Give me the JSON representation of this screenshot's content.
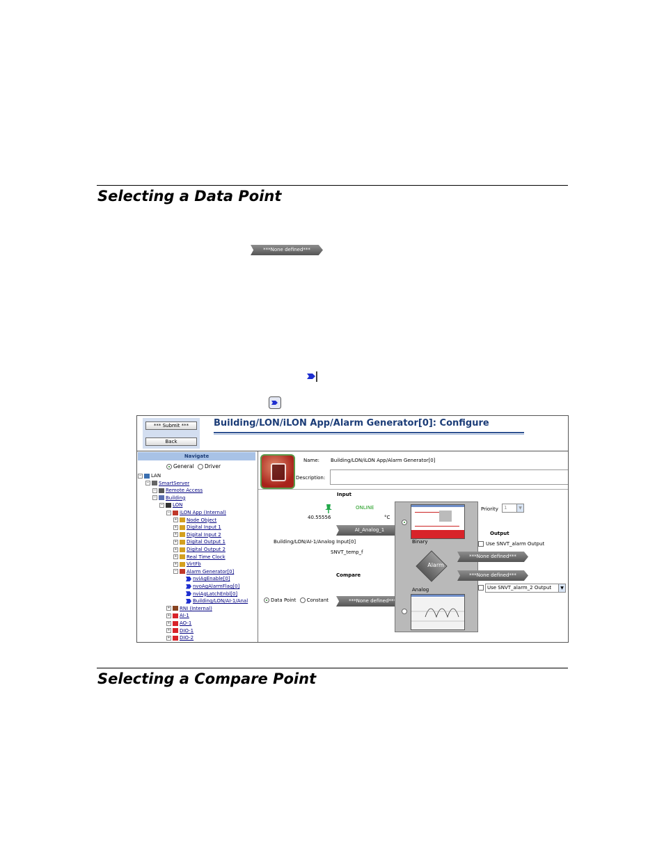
{
  "sections": {
    "data_point_title": "Selecting a Data Point",
    "compare_point_title": "Selecting a Compare Point"
  },
  "inline": {
    "none_defined_tag": "***None defined***"
  },
  "screenshot": {
    "buttons": {
      "submit": "*** Submit ***",
      "back": "Back"
    },
    "title": "Building/LON/iLON App/Alarm Generator[0]: Configure",
    "nav": {
      "header": "Navigate",
      "radio_general": "General",
      "radio_driver": "Driver",
      "tree": [
        {
          "label": "LAN",
          "plain": true
        },
        {
          "label": "SmartServer"
        },
        {
          "label": "Remote Access"
        },
        {
          "label": "Building"
        },
        {
          "label": "LON"
        },
        {
          "label": "iLON App (Internal)"
        },
        {
          "label": "Node Object"
        },
        {
          "label": "Digital Input 1"
        },
        {
          "label": "Digital Input 2"
        },
        {
          "label": "Digital Output 1"
        },
        {
          "label": "Digital Output 2"
        },
        {
          "label": "Real Time Clock"
        },
        {
          "label": "VirtFb"
        },
        {
          "label": "Alarm Generator[0]"
        },
        {
          "label": "nviAgEnable[0]"
        },
        {
          "label": "nvoAgAlarmFlag[0]"
        },
        {
          "label": "nviAgLatchEnbl[0]"
        },
        {
          "label": "Building/LON/AI-1/Anal"
        },
        {
          "label": "RNI (Internal)"
        },
        {
          "label": "AI-1"
        },
        {
          "label": "AO-1"
        },
        {
          "label": "DIO-1"
        },
        {
          "label": "DIO-2"
        }
      ]
    },
    "main": {
      "name_label": "Name:",
      "name_value": "Building/LON/iLON App/Alarm Generator[0]",
      "description_label": "Description:",
      "input_heading": "Input",
      "status": "ONLINE",
      "value": "40.55556",
      "unit": "°C",
      "input_tag": "AI_Analog_1",
      "input_path": "Building/LON/AI-1/Analog Input[0]",
      "input_type": "SNVT_temp_f",
      "compare_heading": "Compare",
      "radio_datapoint": "Data Point",
      "radio_constant": "Constant",
      "compare_tag": "***None defined***",
      "binary_label": "Binary",
      "analog_label": "Analog",
      "alarm_label": "Alarm",
      "priority_label": "Priority",
      "priority_value": "1",
      "output_heading": "Output",
      "use_alarm_output": "Use SNVT_alarm Output",
      "out_tag_1": "***None defined***",
      "out_tag_2": "***None defined***",
      "use_alarm2_output": "Use SNVT_alarm_2 Output"
    }
  }
}
